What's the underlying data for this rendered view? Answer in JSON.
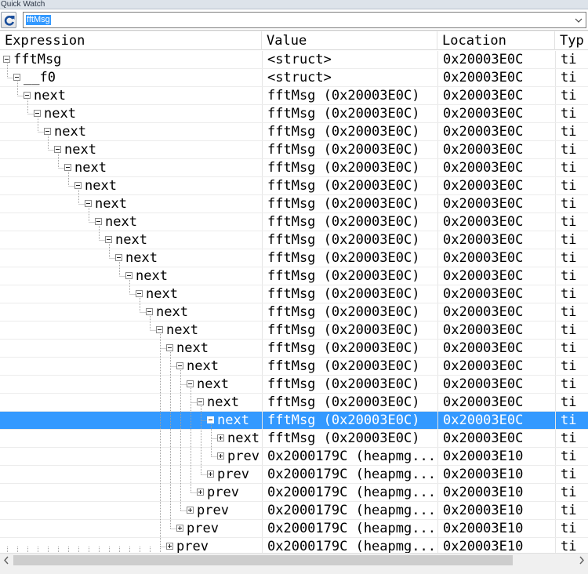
{
  "window": {
    "title": "Quick Watch"
  },
  "toolbar": {
    "refresh_icon": "refresh-icon",
    "expression_value": "fftMsg"
  },
  "columns": [
    "Expression",
    "Value",
    "Location",
    "Typ"
  ],
  "rows": [
    {
      "expr": "fftMsg",
      "depth": 0,
      "toggle": "minus",
      "value": "<struct>",
      "location": "0x20003E0C",
      "type": "ti"
    },
    {
      "expr": "__f0",
      "depth": 1,
      "toggle": "minus",
      "value": "<struct>",
      "location": "0x20003E0C",
      "type": "ti"
    },
    {
      "expr": "next",
      "depth": 2,
      "toggle": "minus",
      "value": "fftMsg (0x20003E0C)",
      "location": "0x20003E0C",
      "type": "ti"
    },
    {
      "expr": "next",
      "depth": 3,
      "toggle": "minus",
      "value": "fftMsg (0x20003E0C)",
      "location": "0x20003E0C",
      "type": "ti"
    },
    {
      "expr": "next",
      "depth": 4,
      "toggle": "minus",
      "value": "fftMsg (0x20003E0C)",
      "location": "0x20003E0C",
      "type": "ti"
    },
    {
      "expr": "next",
      "depth": 5,
      "toggle": "minus",
      "value": "fftMsg (0x20003E0C)",
      "location": "0x20003E0C",
      "type": "ti"
    },
    {
      "expr": "next",
      "depth": 6,
      "toggle": "minus",
      "value": "fftMsg (0x20003E0C)",
      "location": "0x20003E0C",
      "type": "ti"
    },
    {
      "expr": "next",
      "depth": 7,
      "toggle": "minus",
      "value": "fftMsg (0x20003E0C)",
      "location": "0x20003E0C",
      "type": "ti"
    },
    {
      "expr": "next",
      "depth": 8,
      "toggle": "minus",
      "value": "fftMsg (0x20003E0C)",
      "location": "0x20003E0C",
      "type": "ti"
    },
    {
      "expr": "next",
      "depth": 9,
      "toggle": "minus",
      "value": "fftMsg (0x20003E0C)",
      "location": "0x20003E0C",
      "type": "ti"
    },
    {
      "expr": "next",
      "depth": 10,
      "toggle": "minus",
      "value": "fftMsg (0x20003E0C)",
      "location": "0x20003E0C",
      "type": "ti"
    },
    {
      "expr": "next",
      "depth": 11,
      "toggle": "minus",
      "value": "fftMsg (0x20003E0C)",
      "location": "0x20003E0C",
      "type": "ti"
    },
    {
      "expr": "next",
      "depth": 12,
      "toggle": "minus",
      "value": "fftMsg (0x20003E0C)",
      "location": "0x20003E0C",
      "type": "ti"
    },
    {
      "expr": "next",
      "depth": 13,
      "toggle": "minus",
      "value": "fftMsg (0x20003E0C)",
      "location": "0x20003E0C",
      "type": "ti"
    },
    {
      "expr": "next",
      "depth": 14,
      "toggle": "minus",
      "value": "fftMsg (0x20003E0C)",
      "location": "0x20003E0C",
      "type": "ti"
    },
    {
      "expr": "next",
      "depth": 15,
      "toggle": "minus",
      "value": "fftMsg (0x20003E0C)",
      "location": "0x20003E0C",
      "type": "ti"
    },
    {
      "expr": "next",
      "depth": 16,
      "toggle": "minus",
      "value": "fftMsg (0x20003E0C)",
      "location": "0x20003E0C",
      "type": "ti"
    },
    {
      "expr": "next",
      "depth": 17,
      "toggle": "minus",
      "value": "fftMsg (0x20003E0C)",
      "location": "0x20003E0C",
      "type": "ti"
    },
    {
      "expr": "next",
      "depth": 18,
      "toggle": "minus",
      "value": "fftMsg (0x20003E0C)",
      "location": "0x20003E0C",
      "type": "ti"
    },
    {
      "expr": "next",
      "depth": 19,
      "toggle": "minus",
      "value": "fftMsg (0x20003E0C)",
      "location": "0x20003E0C",
      "type": "ti"
    },
    {
      "expr": "next",
      "depth": 20,
      "toggle": "minus",
      "value": "fftMsg (0x20003E0C)",
      "location": "0x20003E0C",
      "type": "ti",
      "selected": true
    },
    {
      "expr": "next",
      "depth": 21,
      "toggle": "plus",
      "value": "fftMsg (0x20003E0C)",
      "location": "0x20003E0C",
      "type": "ti"
    },
    {
      "expr": "prev",
      "depth": 21,
      "toggle": "plus",
      "value": "0x2000179C (heapmg...",
      "location": "0x20003E10",
      "type": "ti"
    },
    {
      "expr": "prev",
      "depth": 20,
      "toggle": "plus",
      "value": "0x2000179C (heapmg...",
      "location": "0x20003E10",
      "type": "ti"
    },
    {
      "expr": "prev",
      "depth": 19,
      "toggle": "plus",
      "value": "0x2000179C (heapmg...",
      "location": "0x20003E10",
      "type": "ti"
    },
    {
      "expr": "prev",
      "depth": 18,
      "toggle": "plus",
      "value": "0x2000179C (heapmg...",
      "location": "0x20003E10",
      "type": "ti"
    },
    {
      "expr": "prev",
      "depth": 17,
      "toggle": "plus",
      "value": "0x2000179C (heapmg...",
      "location": "0x20003E10",
      "type": "ti"
    },
    {
      "expr": "prev",
      "depth": 16,
      "toggle": "plus",
      "value": "0x2000179C (heapmg...",
      "location": "0x20003E10",
      "type": "ti"
    }
  ],
  "colors": {
    "selection": "#3399ff",
    "guides": "#a0a0a0"
  }
}
